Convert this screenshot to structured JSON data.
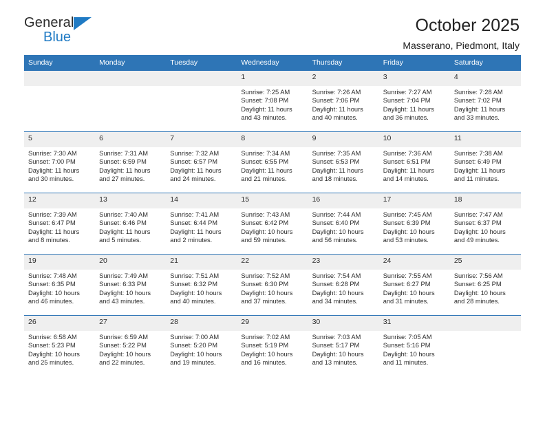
{
  "brand": {
    "name_part1": "General",
    "name_part2": "Blue",
    "triangle_color": "#1f7ac4"
  },
  "header": {
    "title": "October 2025",
    "subtitle": "Masserano, Piedmont, Italy"
  },
  "theme": {
    "header_bg": "#2e75b6",
    "header_text": "#ffffff",
    "daynum_bg": "#efefef",
    "row_border": "#2e75b6"
  },
  "calendar": {
    "weekday_headers": [
      "Sunday",
      "Monday",
      "Tuesday",
      "Wednesday",
      "Thursday",
      "Friday",
      "Saturday"
    ],
    "weeks": [
      [
        {
          "day": "",
          "lines": []
        },
        {
          "day": "",
          "lines": []
        },
        {
          "day": "",
          "lines": []
        },
        {
          "day": "1",
          "lines": [
            "Sunrise: 7:25 AM",
            "Sunset: 7:08 PM",
            "Daylight: 11 hours",
            "and 43 minutes."
          ]
        },
        {
          "day": "2",
          "lines": [
            "Sunrise: 7:26 AM",
            "Sunset: 7:06 PM",
            "Daylight: 11 hours",
            "and 40 minutes."
          ]
        },
        {
          "day": "3",
          "lines": [
            "Sunrise: 7:27 AM",
            "Sunset: 7:04 PM",
            "Daylight: 11 hours",
            "and 36 minutes."
          ]
        },
        {
          "day": "4",
          "lines": [
            "Sunrise: 7:28 AM",
            "Sunset: 7:02 PM",
            "Daylight: 11 hours",
            "and 33 minutes."
          ]
        }
      ],
      [
        {
          "day": "5",
          "lines": [
            "Sunrise: 7:30 AM",
            "Sunset: 7:00 PM",
            "Daylight: 11 hours",
            "and 30 minutes."
          ]
        },
        {
          "day": "6",
          "lines": [
            "Sunrise: 7:31 AM",
            "Sunset: 6:59 PM",
            "Daylight: 11 hours",
            "and 27 minutes."
          ]
        },
        {
          "day": "7",
          "lines": [
            "Sunrise: 7:32 AM",
            "Sunset: 6:57 PM",
            "Daylight: 11 hours",
            "and 24 minutes."
          ]
        },
        {
          "day": "8",
          "lines": [
            "Sunrise: 7:34 AM",
            "Sunset: 6:55 PM",
            "Daylight: 11 hours",
            "and 21 minutes."
          ]
        },
        {
          "day": "9",
          "lines": [
            "Sunrise: 7:35 AM",
            "Sunset: 6:53 PM",
            "Daylight: 11 hours",
            "and 18 minutes."
          ]
        },
        {
          "day": "10",
          "lines": [
            "Sunrise: 7:36 AM",
            "Sunset: 6:51 PM",
            "Daylight: 11 hours",
            "and 14 minutes."
          ]
        },
        {
          "day": "11",
          "lines": [
            "Sunrise: 7:38 AM",
            "Sunset: 6:49 PM",
            "Daylight: 11 hours",
            "and 11 minutes."
          ]
        }
      ],
      [
        {
          "day": "12",
          "lines": [
            "Sunrise: 7:39 AM",
            "Sunset: 6:47 PM",
            "Daylight: 11 hours",
            "and 8 minutes."
          ]
        },
        {
          "day": "13",
          "lines": [
            "Sunrise: 7:40 AM",
            "Sunset: 6:46 PM",
            "Daylight: 11 hours",
            "and 5 minutes."
          ]
        },
        {
          "day": "14",
          "lines": [
            "Sunrise: 7:41 AM",
            "Sunset: 6:44 PM",
            "Daylight: 11 hours",
            "and 2 minutes."
          ]
        },
        {
          "day": "15",
          "lines": [
            "Sunrise: 7:43 AM",
            "Sunset: 6:42 PM",
            "Daylight: 10 hours",
            "and 59 minutes."
          ]
        },
        {
          "day": "16",
          "lines": [
            "Sunrise: 7:44 AM",
            "Sunset: 6:40 PM",
            "Daylight: 10 hours",
            "and 56 minutes."
          ]
        },
        {
          "day": "17",
          "lines": [
            "Sunrise: 7:45 AM",
            "Sunset: 6:39 PM",
            "Daylight: 10 hours",
            "and 53 minutes."
          ]
        },
        {
          "day": "18",
          "lines": [
            "Sunrise: 7:47 AM",
            "Sunset: 6:37 PM",
            "Daylight: 10 hours",
            "and 49 minutes."
          ]
        }
      ],
      [
        {
          "day": "19",
          "lines": [
            "Sunrise: 7:48 AM",
            "Sunset: 6:35 PM",
            "Daylight: 10 hours",
            "and 46 minutes."
          ]
        },
        {
          "day": "20",
          "lines": [
            "Sunrise: 7:49 AM",
            "Sunset: 6:33 PM",
            "Daylight: 10 hours",
            "and 43 minutes."
          ]
        },
        {
          "day": "21",
          "lines": [
            "Sunrise: 7:51 AM",
            "Sunset: 6:32 PM",
            "Daylight: 10 hours",
            "and 40 minutes."
          ]
        },
        {
          "day": "22",
          "lines": [
            "Sunrise: 7:52 AM",
            "Sunset: 6:30 PM",
            "Daylight: 10 hours",
            "and 37 minutes."
          ]
        },
        {
          "day": "23",
          "lines": [
            "Sunrise: 7:54 AM",
            "Sunset: 6:28 PM",
            "Daylight: 10 hours",
            "and 34 minutes."
          ]
        },
        {
          "day": "24",
          "lines": [
            "Sunrise: 7:55 AM",
            "Sunset: 6:27 PM",
            "Daylight: 10 hours",
            "and 31 minutes."
          ]
        },
        {
          "day": "25",
          "lines": [
            "Sunrise: 7:56 AM",
            "Sunset: 6:25 PM",
            "Daylight: 10 hours",
            "and 28 minutes."
          ]
        }
      ],
      [
        {
          "day": "26",
          "lines": [
            "Sunrise: 6:58 AM",
            "Sunset: 5:23 PM",
            "Daylight: 10 hours",
            "and 25 minutes."
          ]
        },
        {
          "day": "27",
          "lines": [
            "Sunrise: 6:59 AM",
            "Sunset: 5:22 PM",
            "Daylight: 10 hours",
            "and 22 minutes."
          ]
        },
        {
          "day": "28",
          "lines": [
            "Sunrise: 7:00 AM",
            "Sunset: 5:20 PM",
            "Daylight: 10 hours",
            "and 19 minutes."
          ]
        },
        {
          "day": "29",
          "lines": [
            "Sunrise: 7:02 AM",
            "Sunset: 5:19 PM",
            "Daylight: 10 hours",
            "and 16 minutes."
          ]
        },
        {
          "day": "30",
          "lines": [
            "Sunrise: 7:03 AM",
            "Sunset: 5:17 PM",
            "Daylight: 10 hours",
            "and 13 minutes."
          ]
        },
        {
          "day": "31",
          "lines": [
            "Sunrise: 7:05 AM",
            "Sunset: 5:16 PM",
            "Daylight: 10 hours",
            "and 11 minutes."
          ]
        },
        {
          "day": "",
          "lines": []
        }
      ]
    ]
  }
}
